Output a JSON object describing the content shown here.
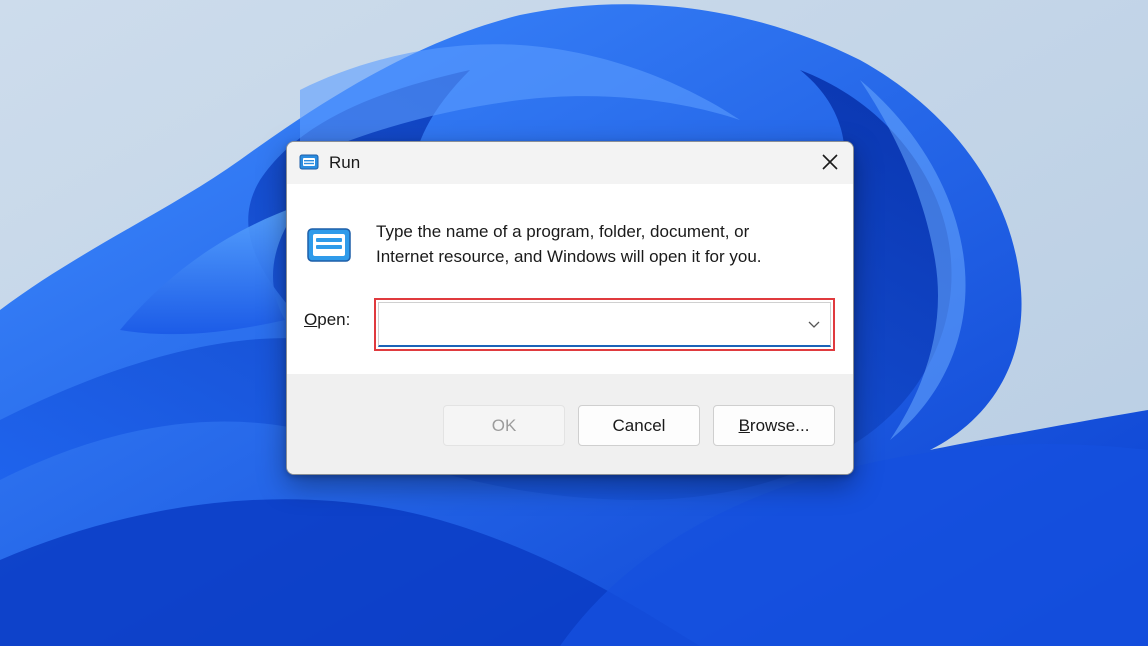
{
  "dialog": {
    "title": "Run",
    "description_line1": "Type the name of a program, folder, document, or",
    "description_line2": "Internet resource, and Windows will open it for you.",
    "open_label_mnemonic": "O",
    "open_label_rest": "pen:",
    "open_value": "",
    "ok_label": "OK",
    "cancel_label": "Cancel",
    "browse_mnemonic": "B",
    "browse_rest": "rowse...",
    "highlight_color": "#e03a3e",
    "accent_color": "#1b63b8"
  },
  "icons": {
    "title": "run-app-icon",
    "content": "run-app-icon",
    "close": "close-icon",
    "dropdown": "chevron-down-icon"
  }
}
